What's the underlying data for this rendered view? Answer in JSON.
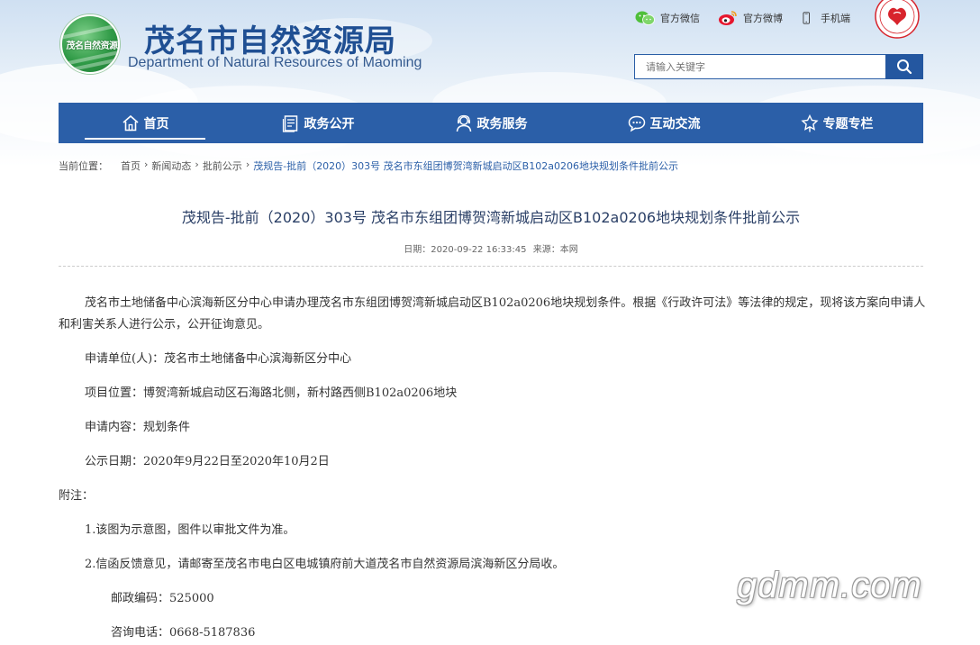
{
  "header": {
    "emblem_text": "茂名自然资源",
    "title": "茂名市自然资源局",
    "subtitle": "Department of Natural Resources of Maoming",
    "links": [
      {
        "label": "官方微信",
        "icon": "wechat-icon"
      },
      {
        "label": "官方微博",
        "icon": "weibo-icon"
      },
      {
        "label": "手机端",
        "icon": "mobile-icon"
      }
    ],
    "badge_icon": "red-emblem-icon"
  },
  "search": {
    "placeholder": "请输入关键字",
    "icon": "search-icon"
  },
  "nav": {
    "items": [
      {
        "label": "首页",
        "icon": "home-icon"
      },
      {
        "label": "政务公开",
        "icon": "document-icon"
      },
      {
        "label": "政务服务",
        "icon": "service-icon"
      },
      {
        "label": "互动交流",
        "icon": "chat-icon"
      },
      {
        "label": "专题专栏",
        "icon": "topic-icon"
      }
    ],
    "active_index": 0,
    "color": "#2b5fa8"
  },
  "breadcrumb": {
    "prefix": "当前位置：",
    "items": [
      "首页",
      "新闻动态",
      "批前公示",
      "茂规告-批前（2020）303号 茂名市东组团博贺湾新城启动区B102a0206地块规划条件批前公示"
    ],
    "separator": "›"
  },
  "article": {
    "title": "茂规告-批前（2020）303号 茂名市东组团博贺湾新城启动区B102a0206地块规划条件批前公示",
    "date_label": "日期：",
    "date": "2020-09-22 16:33:45",
    "source_label": "来源：",
    "source": "本网",
    "paragraphs": {
      "p1": "茂名市土地储备中心滨海新区分中心申请办理茂名市东组团博贺湾新城启动区B102a0206地块规划条件。根据《行政许可法》等法律的规定，现将该方案向申请人和利害关系人进行公示，公开征询意见。",
      "p2": "申请单位(人)：茂名市土地储备中心滨海新区分中心",
      "p3": "项目位置：博贺湾新城启动区石海路北侧，新村路西侧B102a0206地块",
      "p4": "申请内容：规划条件",
      "p5": "公示日期：2020年9月22日至2020年10月2日",
      "p6": "附注：",
      "p7": "1.该图为示意图，图件以审批文件为准。",
      "p8": "2.信函反馈意见，请邮寄至茂名市电白区电城镇府前大道茂名市自然资源局滨海新区分局收。",
      "p9": "邮政编码：525000",
      "p10": "咨询电话：0668-5187836"
    }
  },
  "watermark": "gdmm.com"
}
